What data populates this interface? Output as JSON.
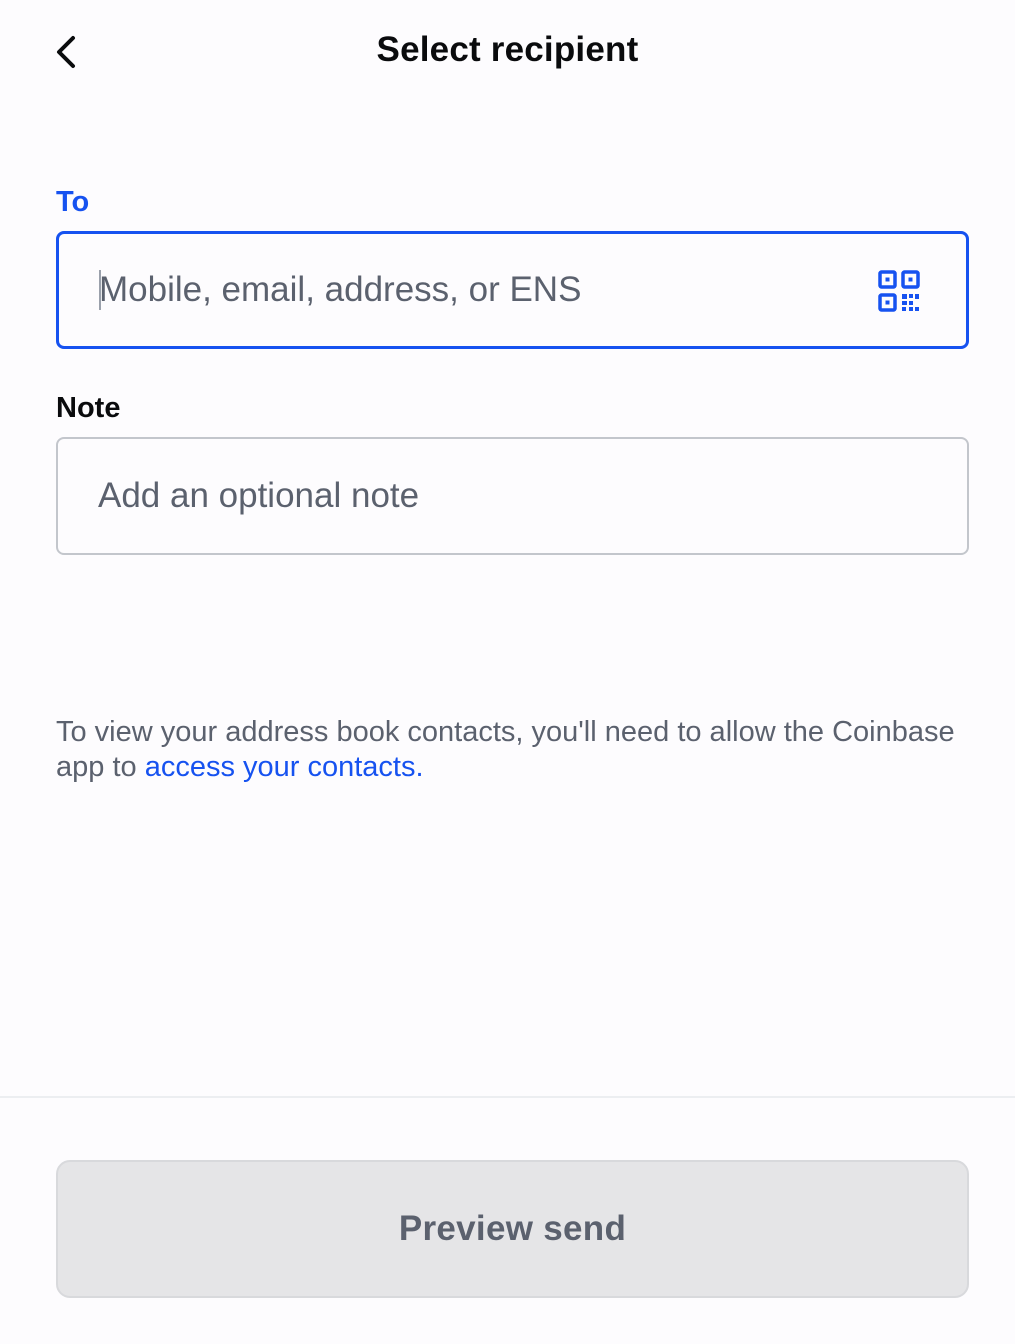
{
  "header": {
    "title": "Select recipient",
    "back_icon": "chevron-left-icon"
  },
  "to_field": {
    "label": "To",
    "value": "",
    "placeholder": "Mobile, email, address, or ENS",
    "scan_icon": "qr-code-icon"
  },
  "note_field": {
    "label": "Note",
    "value": "",
    "placeholder": "Add an optional note"
  },
  "contacts_notice": {
    "text": "To view your address book contacts, you'll need to allow the Coinbase app to ",
    "link_text": "access your contacts."
  },
  "footer": {
    "preview_label": "Preview send"
  },
  "colors": {
    "accent": "#1652f0",
    "muted_text": "#5b616e",
    "disabled_button": "#e5e5e7"
  }
}
